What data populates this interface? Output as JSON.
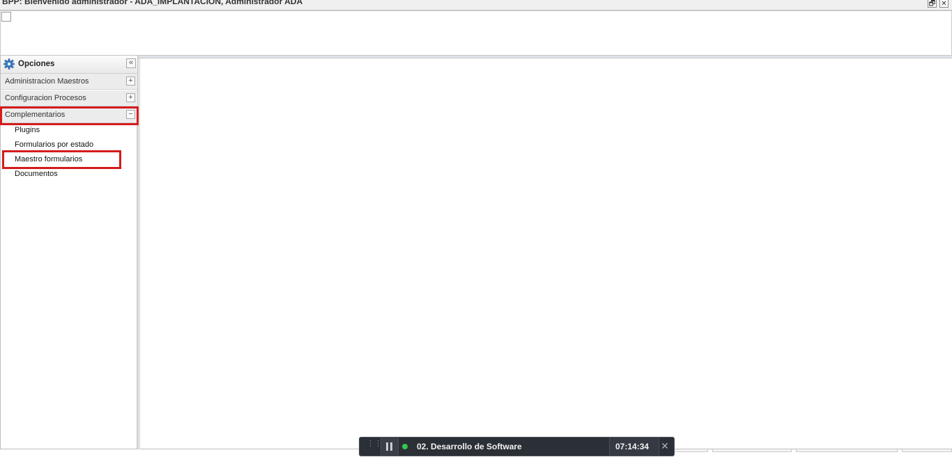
{
  "window": {
    "title": "BPP: Bienvenido administrador - ADA_IMPLANTACION, Administrador ADA",
    "restore_label": "🗗",
    "close_label": "✕"
  },
  "sidebar": {
    "header": {
      "label": "Opciones",
      "collapse_label": "«",
      "icon": "gear-icon"
    },
    "sections": [
      {
        "label": "Administracion Maestros",
        "toggle": "+"
      },
      {
        "label": "Configuracion Procesos",
        "toggle": "+"
      },
      {
        "label": "Complementarios",
        "toggle": "−"
      }
    ],
    "items": [
      {
        "label": "Plugins"
      },
      {
        "label": "Formularios por estado"
      },
      {
        "label": "Maestro formularios"
      },
      {
        "label": "Documentos"
      }
    ]
  },
  "recorder": {
    "label": "02. Desarrollo de Software",
    "time": "07:14:34",
    "close_label": "✕",
    "status_color": "#35c74b"
  },
  "highlight_color": "#d51b1b"
}
